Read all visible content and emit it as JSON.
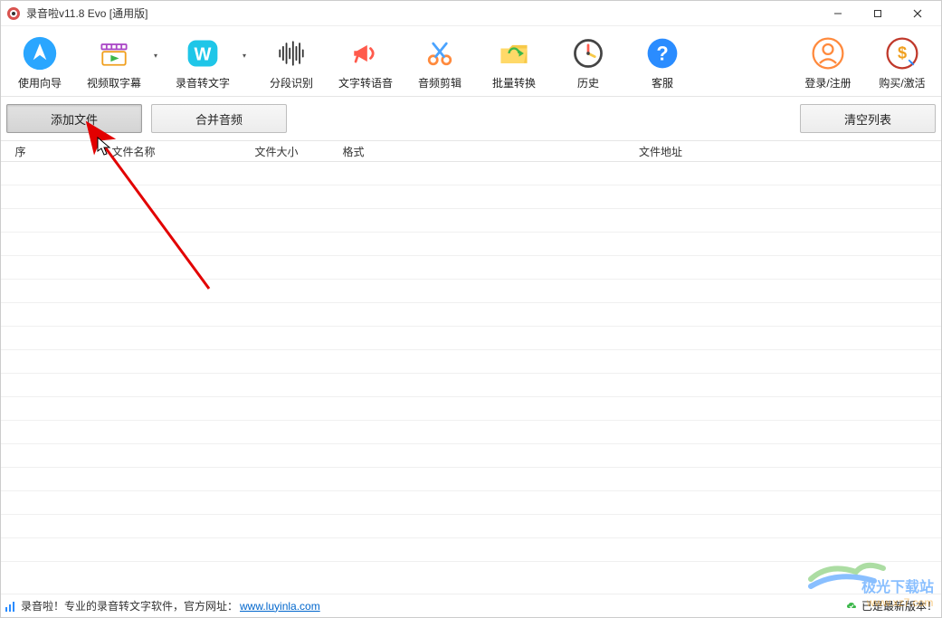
{
  "window": {
    "title": "录音啦v11.8 Evo [通用版]"
  },
  "toolbar": {
    "items": [
      {
        "label": "使用向导"
      },
      {
        "label": "视频取字幕"
      },
      {
        "label": "录音转文字"
      },
      {
        "label": "分段识别"
      },
      {
        "label": "文字转语音"
      },
      {
        "label": "音频剪辑"
      },
      {
        "label": "批量转换"
      },
      {
        "label": "历史"
      },
      {
        "label": "客服"
      },
      {
        "label": "登录/注册"
      },
      {
        "label": "购买/激活"
      }
    ]
  },
  "actions": {
    "add_file": "添加文件",
    "merge_audio": "合并音频",
    "clear_list": "清空列表"
  },
  "table": {
    "headers": {
      "seq": "序",
      "name": "文件名称",
      "size": "文件大小",
      "format": "格式",
      "path": "文件地址"
    }
  },
  "status": {
    "left_prefix": "录音啦！专业的录音转文字软件，官方网址：",
    "url": "www.luyinla.com",
    "right": "已是最新版本！"
  },
  "watermark": {
    "line1": "极光下载站",
    "line2": "www.xz7.com"
  }
}
